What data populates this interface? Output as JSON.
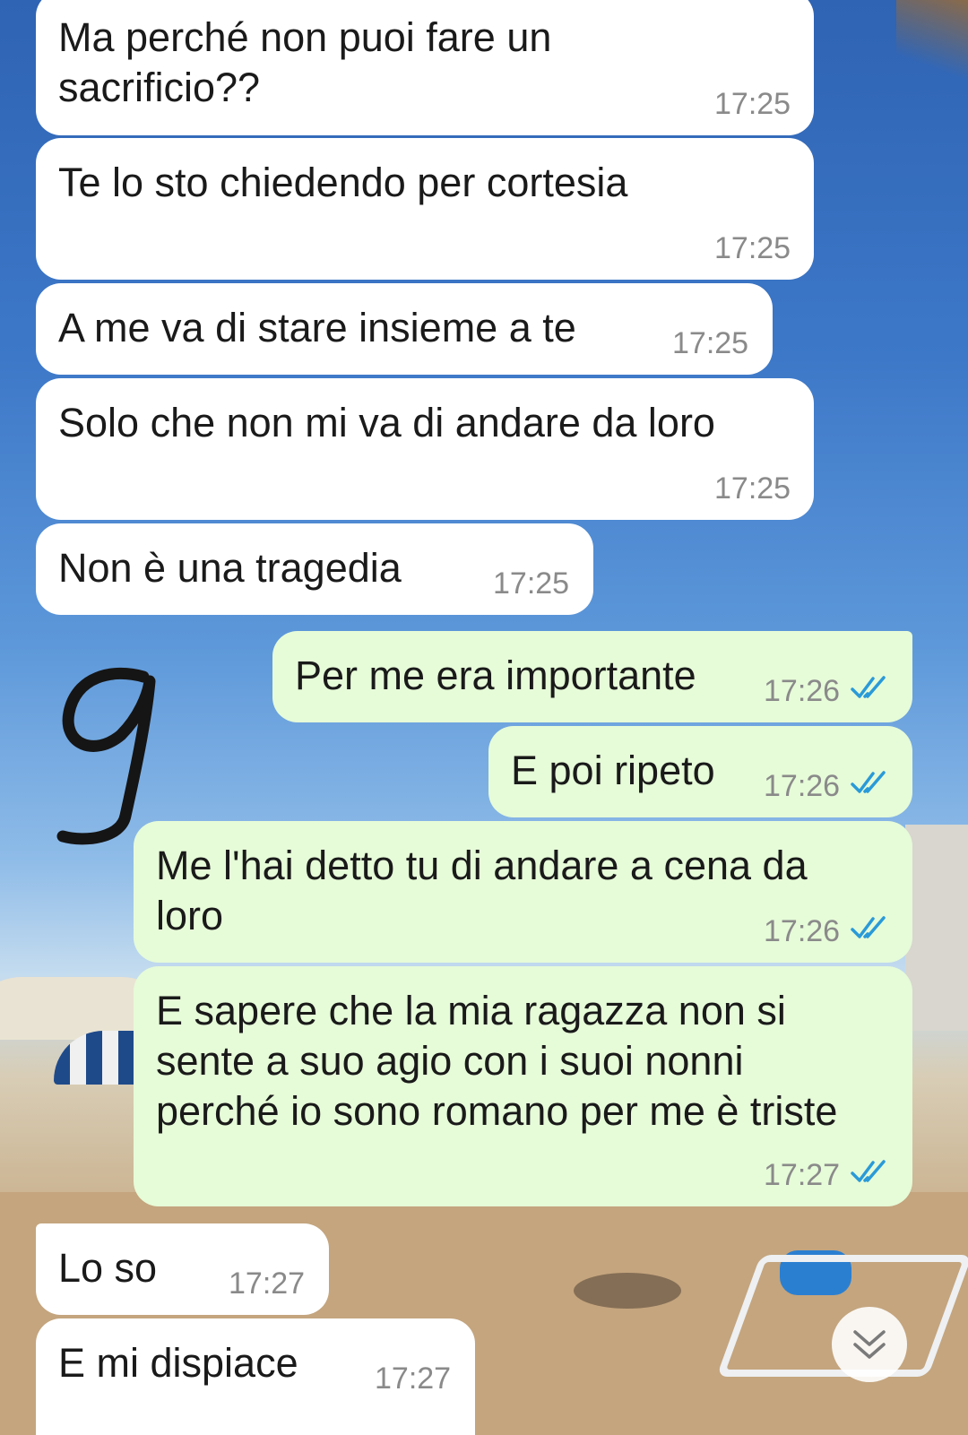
{
  "messages": [
    {
      "text": "Ma perché non puoi fare un\nsacrificio??",
      "time": "17:25"
    },
    {
      "text": "Te lo sto chiedendo per cortesia",
      "time": "17:25"
    },
    {
      "text": "A me va di stare insieme a te",
      "time": "17:25"
    },
    {
      "text": "Solo che non mi va di andare da loro",
      "time": "17:25"
    },
    {
      "text": "Non è una tragedia",
      "time": "17:25"
    },
    {
      "text": "Per me era importante",
      "time": "17:26"
    },
    {
      "text": "E poi ripeto",
      "time": "17:26"
    },
    {
      "text": "Me l'hai detto tu di andare a cena da\nloro",
      "time": "17:26"
    },
    {
      "text": "E sapere che la mia ragazza non si\nsente a suo agio con i suoi nonni\nperché io sono romano per me è triste",
      "time": "17:27"
    },
    {
      "text": "Lo so",
      "time": "17:27"
    },
    {
      "text": "E mi dispiace",
      "time": "17:27"
    }
  ],
  "colors": {
    "incoming_bubble": "#ffffff",
    "outgoing_bubble": "#e6fbd8",
    "read_ticks": "#2a9ad8",
    "timestamp": "#8a8a8a"
  },
  "icons": {
    "read_receipt": "double-check-icon",
    "scroll_down": "double-chevron-down-icon"
  }
}
